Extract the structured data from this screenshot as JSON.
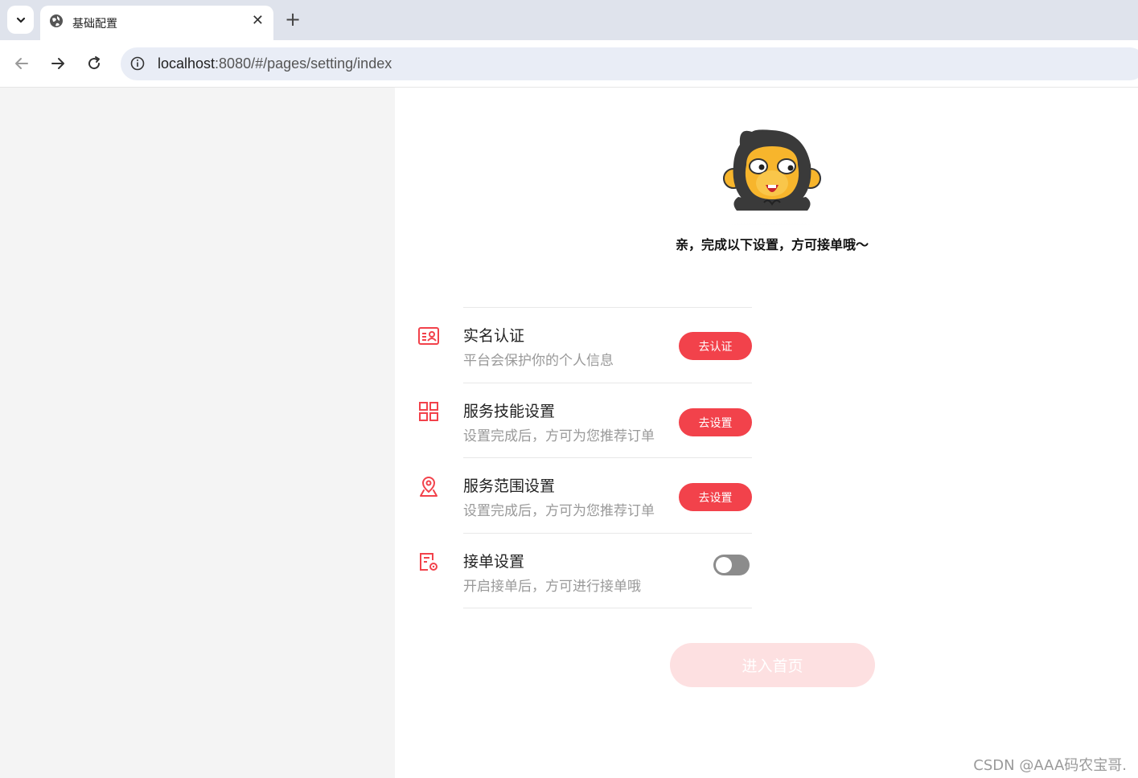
{
  "browser": {
    "tab_title": "基础配置",
    "url_host": "localhost",
    "url_rest": ":8080/#/pages/setting/index"
  },
  "page": {
    "greeting": "亲，完成以下设置，方可接单哦～",
    "settings": [
      {
        "title": "实名认证",
        "subtitle": "平台会保护你的个人信息",
        "action": "去认证",
        "icon": "id-card-icon"
      },
      {
        "title": "服务技能设置",
        "subtitle": "设置完成后，方可为您推荐订单",
        "action": "去设置",
        "icon": "grid-icon"
      },
      {
        "title": "服务范围设置",
        "subtitle": "设置完成后，方可为您推荐订单",
        "action": "去设置",
        "icon": "location-pin-icon"
      },
      {
        "title": "接单设置",
        "subtitle": "开启接单后，方可进行接单哦",
        "toggle_on": false,
        "icon": "document-gear-icon"
      }
    ],
    "enter_button": "进入首页",
    "watermark": "CSDN @AAA码农宝哥.",
    "accent_color": "#f2424b"
  }
}
